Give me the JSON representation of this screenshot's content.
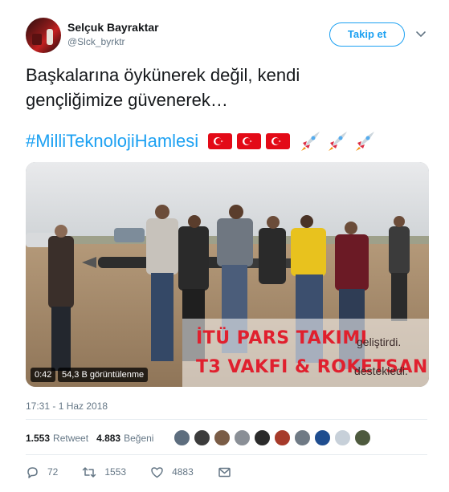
{
  "user": {
    "name": "Selçuk Bayraktar",
    "handle": "@Slck_byrktr"
  },
  "follow_label": "Takip et",
  "tweet": {
    "line1": "Başkalarına öykünerek değil, kendi",
    "line2": "gençliğimize güvenerek…",
    "hashtag": "#MilliTeknolojiHamlesi",
    "emoji": [
      "turkey-flag",
      "turkey-flag",
      "turkey-flag",
      "rocket",
      "rocket",
      "rocket"
    ]
  },
  "media": {
    "overlay_line1": "İTÜ PARS TAKIMI",
    "overlay_line1_suffix": "geliştirdi.",
    "overlay_line2": "T3 VAKFI & ROKETSAN",
    "overlay_line2_suffix": "destekledi.",
    "duration": "0:42",
    "views": "54,3 B görüntülenme"
  },
  "timestamp": "17:31 - 1 Haz 2018",
  "stats": {
    "retweets": "1.553",
    "retweets_label": "Retweet",
    "likes": "4.883",
    "likes_label": "Beğeni"
  },
  "actions": {
    "replies": "72",
    "retweets": "1553",
    "likes": "4883"
  },
  "colors": {
    "accent": "#1da1f2",
    "overlay_red": "#e0202e",
    "flag_red": "#e30a17"
  }
}
